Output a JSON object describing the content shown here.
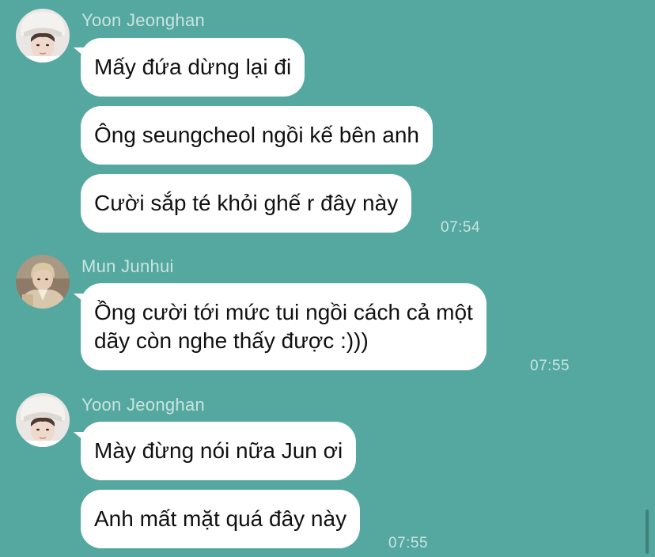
{
  "colors": {
    "background": "#54a8a0",
    "bubble": "#ffffff",
    "message_text": "#111111",
    "meta_text": "#c9e4e0",
    "scroll_indicator": "#3f8079"
  },
  "groups": [
    {
      "sender": "Yoon Jeonghan",
      "avatar_icon": "avatar-photo",
      "messages": [
        {
          "lines": [
            "Mấy đứa dừng lại đi"
          ]
        },
        {
          "lines": [
            "Ông seungcheol ngồi kế bên anh"
          ]
        },
        {
          "lines": [
            "Cười sắp té khỏi ghế r đây này"
          ]
        }
      ],
      "time": "07:54"
    },
    {
      "sender": "Mun Junhui",
      "avatar_icon": "avatar-photo",
      "messages": [
        {
          "lines": [
            "Ồng cười tới mức tui ngồi cách cả một",
            "dãy còn nghe thấy được :)))"
          ]
        }
      ],
      "time": "07:55"
    },
    {
      "sender": "Yoon Jeonghan",
      "avatar_icon": "avatar-photo",
      "messages": [
        {
          "lines": [
            "Mày đừng nói nữa Jun ơi"
          ]
        },
        {
          "lines": [
            "Anh mất mặt quá đây này"
          ]
        }
      ],
      "time": "07:55"
    }
  ]
}
